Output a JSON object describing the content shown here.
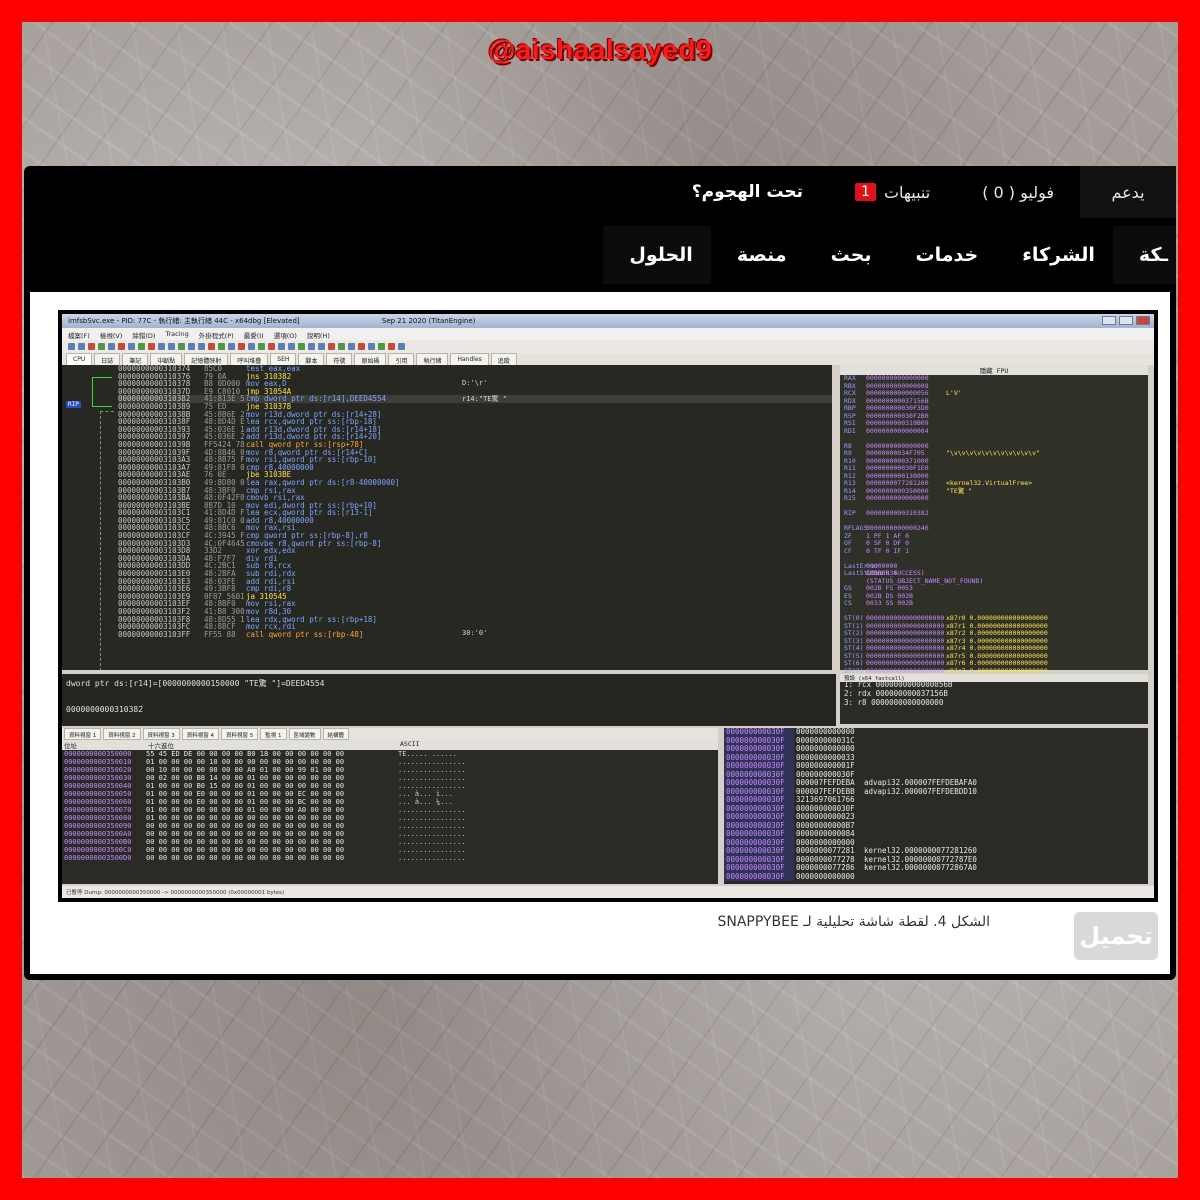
{
  "watermark": "@aishaalsayed9",
  "topbar": {
    "support": "يدعم",
    "follow": "فوليو ( 0 )",
    "alerts_label": "تنبيهات",
    "alerts_count": "1",
    "under_attack": "تحت الهجوم؟"
  },
  "nav": {
    "items": [
      "ـكة",
      "الشركاء",
      "خدمات",
      "بحث",
      "منصة",
      "الحلول"
    ]
  },
  "screenshot": {
    "title": "imfsbSvc.exe - PID: 77C - 執行緒: 主執行緒 44C - x64dbg [Elevated]",
    "date": "Sep 21 2020 (TitanEngine)",
    "menu": [
      "檔案(F)",
      "檢視(V)",
      "除錯(D)",
      "Tracing",
      "外掛程式(P)",
      "最愛(I)",
      "選項(O)",
      "說明(H)"
    ],
    "tabs": [
      "CPU",
      "日誌",
      "筆記",
      "中斷點",
      "記憶體映射",
      "呼叫堆疊",
      "SEH",
      "腳本",
      "符號",
      "原始碼",
      "引用",
      "執行緒",
      "Handles",
      "追蹤"
    ],
    "rip_label": "RIP",
    "disasm": [
      {
        "addr": "0000000000310374",
        "bytes": "85C0",
        "ins": "test eax,eax"
      },
      {
        "addr": "0000000000310376",
        "bytes": "79 0A",
        "ins": "jns 310382"
      },
      {
        "addr": "0000000000310378",
        "bytes": "B8 0D000",
        "ins": "mov eax,D"
      },
      {
        "addr": "000000000031037D",
        "bytes": "E9 C8010",
        "ins": "jmp 31054A"
      },
      {
        "addr": "0000000000310382",
        "bytes": "41:813E 5",
        "ins": "cmp dword ptr ds:[r14],DEED4554"
      },
      {
        "addr": "0000000000310389",
        "bytes": "75 ED",
        "ins": "jne 310378"
      },
      {
        "addr": "000000000031038B",
        "bytes": "45:8B6E 2",
        "ins": "mov r13d,dword ptr ds:[r14+28]"
      },
      {
        "addr": "000000000031038F",
        "bytes": "48:8D4D E",
        "ins": "lea rcx,qword ptr ss:[rbp-18]"
      },
      {
        "addr": "0000000000310393",
        "bytes": "45:036E 1",
        "ins": "add r13d,dword ptr ds:[r14+18]"
      },
      {
        "addr": "0000000000310397",
        "bytes": "45:036E 2",
        "ins": "add r13d,dword ptr ds:[r14+20]"
      },
      {
        "addr": "000000000031039B",
        "bytes": "FF5424 78",
        "ins": "call qword ptr ss:[rsp+78]"
      },
      {
        "addr": "000000000031039F",
        "bytes": "4D:8B46 0",
        "ins": "mov r8,qword ptr ds:[r14+C]"
      },
      {
        "addr": "00000000003103A3",
        "bytes": "48:8B75 F",
        "ins": "mov rsi,qword ptr ss:[rbp-10]"
      },
      {
        "addr": "00000000003103A7",
        "bytes": "49:81F8 0",
        "ins": "cmp r8,40000000"
      },
      {
        "addr": "00000000003103AE",
        "bytes": "76 0E",
        "ins": "jbe 3103BE"
      },
      {
        "addr": "00000000003103B0",
        "bytes": "49:8D80 0",
        "ins": "lea rax,qword ptr ds:[r8-40000000]"
      },
      {
        "addr": "00000000003103B7",
        "bytes": "48:3BF0",
        "ins": "cmp rsi,rax"
      },
      {
        "addr": "00000000003103BA",
        "bytes": "48:0F42F0",
        "ins": "cmovb rsi,rax"
      },
      {
        "addr": "00000000003103BE",
        "bytes": "8B7D 10",
        "ins": "mov edi,dword ptr ss:[rbp+10]"
      },
      {
        "addr": "00000000003103C1",
        "bytes": "41:8D4D F",
        "ins": "lea ecx,qword ptr ds:[r13-1]"
      },
      {
        "addr": "00000000003103C5",
        "bytes": "49:81C0 0",
        "ins": "add r8,40000000"
      },
      {
        "addr": "00000000003103CC",
        "bytes": "48:8BC6",
        "ins": "mov rax,rsi"
      },
      {
        "addr": "00000000003103CF",
        "bytes": "4C:3945 F",
        "ins": "cmp qword ptr ss:[rbp-8],r8"
      },
      {
        "addr": "00000000003103D3",
        "bytes": "4C:0F4645",
        "ins": "cmovbe r8,qword ptr ss:[rbp-8]"
      },
      {
        "addr": "00000000003103D8",
        "bytes": "33D2",
        "ins": "xor edx,edx"
      },
      {
        "addr": "00000000003103DA",
        "bytes": "48:F7F7",
        "ins": "div rdi"
      },
      {
        "addr": "00000000003103DD",
        "bytes": "4C:2BC1",
        "ins": "sub r8,rcx"
      },
      {
        "addr": "00000000003103E0",
        "bytes": "48:2BFA",
        "ins": "sub rdi,rdx"
      },
      {
        "addr": "00000000003103E3",
        "bytes": "48:03FE",
        "ins": "add rdi,rsi"
      },
      {
        "addr": "00000000003103E6",
        "bytes": "49:3BF8",
        "ins": "cmp rdi,r8"
      },
      {
        "addr": "00000000003103E9",
        "bytes": "0F87 5601",
        "ins": "ja 310545"
      },
      {
        "addr": "00000000003103EF",
        "bytes": "48:8BF0",
        "ins": "mov rsi,rax"
      },
      {
        "addr": "00000000003103F2",
        "bytes": "41:B8 300",
        "ins": "mov r8d,30"
      },
      {
        "addr": "00000000003103F8",
        "bytes": "48:8D55 1",
        "ins": "lea rdx,qword ptr ss:[rbp+18]"
      },
      {
        "addr": "00000000003103FC",
        "bytes": "48:8BCF",
        "ins": "mov rcx,rdi"
      },
      {
        "addr": "00000000003103FF",
        "bytes": "FF55 88",
        "ins": "call qword ptr ss:[rbp-48]"
      }
    ],
    "comments": [
      "D:'\\r'",
      "r14:\"TE驚 \"",
      "30:'0'"
    ],
    "regs_header": "隱藏 FPU",
    "regs": [
      {
        "n": "RAX",
        "v": "0000000000000000",
        "c": ""
      },
      {
        "n": "RBX",
        "v": "0000000000000008",
        "c": ""
      },
      {
        "n": "RCX",
        "v": "0000000000000056",
        "c": "L'V'"
      },
      {
        "n": "RDX",
        "v": "000000000037156B",
        "c": ""
      },
      {
        "n": "RBP",
        "v": "000000000030F3D0",
        "c": ""
      },
      {
        "n": "RSP",
        "v": "000000000030F2B0",
        "c": ""
      },
      {
        "n": "RSI",
        "v": "0000000000310B09",
        "c": ""
      },
      {
        "n": "RDI",
        "v": "0000000000000004",
        "c": ""
      },
      {
        "n": "",
        "v": "",
        "c": ""
      },
      {
        "n": "R8",
        "v": "0000000000000000",
        "c": ""
      },
      {
        "n": "R9",
        "v": "00000000034F705",
        "c": "\"\\v\\v\\v\\v\\v\\v\\v\\v\\v\\v\\v\""
      },
      {
        "n": "R10",
        "v": "0000000000371000",
        "c": ""
      },
      {
        "n": "R11",
        "v": "000000000030F1E0",
        "c": ""
      },
      {
        "n": "R12",
        "v": "0000000000130000",
        "c": ""
      },
      {
        "n": "R13",
        "v": "0000000077281260",
        "c": "<kernel32.VirtualFree>"
      },
      {
        "n": "R14",
        "v": "0000000000350000",
        "c": "\"TE驚 \""
      },
      {
        "n": "R15",
        "v": "0000000000000000",
        "c": ""
      },
      {
        "n": "",
        "v": "",
        "c": ""
      },
      {
        "n": "RIP",
        "v": "0000000000310382",
        "c": ""
      },
      {
        "n": "",
        "v": "",
        "c": ""
      },
      {
        "n": "RFLAGS",
        "v": "0000000000000246",
        "c": ""
      },
      {
        "n": "ZF",
        "v": "1  PF 1  AF 0",
        "c": ""
      },
      {
        "n": "OF",
        "v": "0  SF 0  DF 0",
        "c": ""
      },
      {
        "n": "CF",
        "v": "0  TF 0  IF 1",
        "c": ""
      },
      {
        "n": "",
        "v": "",
        "c": ""
      },
      {
        "n": "LastError",
        "v": "00000000 (ERROR_SUCCESS)",
        "c": ""
      },
      {
        "n": "LastStatus",
        "v": "C0000034 (STATUS_OBJECT_NAME_NOT_FOUND)",
        "c": ""
      },
      {
        "n": "",
        "v": "",
        "c": ""
      },
      {
        "n": "GS",
        "v": "002B  FS 0053",
        "c": ""
      },
      {
        "n": "ES",
        "v": "002B  DS 002B",
        "c": ""
      },
      {
        "n": "CS",
        "v": "0033  SS 002B",
        "c": ""
      },
      {
        "n": "",
        "v": "",
        "c": ""
      },
      {
        "n": "ST(0)",
        "v": "00000000000000000000",
        "c": "x87r0 0.000000000000000000"
      },
      {
        "n": "ST(1)",
        "v": "00000000000000000000",
        "c": "x87r1 0.000000000000000000"
      },
      {
        "n": "ST(2)",
        "v": "00000000000000000000",
        "c": "x87r2 0.000000000000000000"
      },
      {
        "n": "ST(3)",
        "v": "00000000000000000000",
        "c": "x87r3 0.000000000000000000"
      },
      {
        "n": "ST(4)",
        "v": "00000000000000000000",
        "c": "x87r4 0.000000000000000000"
      },
      {
        "n": "ST(5)",
        "v": "00000000000000000000",
        "c": "x87r5 0.000000000000000000"
      },
      {
        "n": "ST(6)",
        "v": "00000000000000000000",
        "c": "x87r6 0.000000000000000000"
      },
      {
        "n": "ST(7)",
        "v": "00000000000000000000",
        "c": "x87r7 0.000000000000000000"
      }
    ],
    "stackmini_header": "預設 (x64 fastcall)",
    "stackmini": [
      "1:  rcx 0000000000000056B",
      "2:  rdx 000000000037156B",
      "3:  r8 0000000000000000"
    ],
    "info_line1": "dword ptr ds:[r14]=[0000000000150000 \"TE驚 \"]=DEED4554",
    "info_line2": "0000000000310382",
    "dump_tabs": [
      "資料視窗 1",
      "資料視窗 2",
      "資料視窗 3",
      "資料視窗 4",
      "資料視窗 5",
      "監視 1",
      "區域變數",
      "結構體"
    ],
    "dump_headers": [
      "位址",
      "十六進位",
      "ASCII"
    ],
    "dump": [
      {
        "a": "0000000000350000",
        "x": "55 45 ED DE 00 00 00 00 B0 18 00 00 00 00 00 00",
        "s": "TE.....  ......"
      },
      {
        "a": "0000000000350010",
        "x": "01 00 00 00 00 10 00 00 00 00 00 00 00 00 00 00",
        "s": "................"
      },
      {
        "a": "0000000000350020",
        "x": "00 10 00 00 00 00 00 00 A0 01 00 00 99 01 00 00",
        "s": "................"
      },
      {
        "a": "0000000000350030",
        "x": "00 02 00 00 B8 14 00 00 01 00 00 00 00 00 00 00",
        "s": "................"
      },
      {
        "a": "0000000000350040",
        "x": "01 00 00 00 B0 15 00 00 01 00 00 00 00 00 00 00",
        "s": "................"
      },
      {
        "a": "0000000000350050",
        "x": "01 00 00 00 E0 00 00 00 01 00 00 00 EC 00 00 00",
        "s": "...  à...   ì..."
      },
      {
        "a": "0000000000350060",
        "x": "01 00 00 00 E0 00 00 00 01 00 00 00 BC 00 00 00",
        "s": "...  à...   ¼..."
      },
      {
        "a": "0000000000350070",
        "x": "01 00 00 00 00 00 00 00 01 00 00 00 A0 00 00 00",
        "s": "................"
      },
      {
        "a": "0000000000350080",
        "x": "01 00 00 00 00 00 00 00 00 00 00 00 00 00 00 00",
        "s": "................"
      },
      {
        "a": "0000000000350090",
        "x": "00 00 00 00 00 00 00 00 00 00 00 00 00 00 00 00",
        "s": "................"
      },
      {
        "a": "00000000003500A0",
        "x": "00 00 00 00 00 00 00 00 00 00 00 00 00 00 00 00",
        "s": "................"
      },
      {
        "a": "00000000003500B0",
        "x": "00 00 00 00 00 00 00 00 00 00 00 00 00 00 00 00",
        "s": "................"
      },
      {
        "a": "00000000003500C0",
        "x": "00 00 00 00 00 00 00 00 00 00 00 00 00 00 00 00",
        "s": "................"
      },
      {
        "a": "00000000003500D0",
        "x": "00 00 00 00 00 00 00 00 00 00 00 00 00 00 00 00",
        "s": "................"
      }
    ],
    "stack2": [
      {
        "a": "000000000030F",
        "v": "0000000000000",
        "c": ""
      },
      {
        "a": "000000000030F",
        "v": "000000000031C",
        "c": ""
      },
      {
        "a": "000000000030F",
        "v": "0000000000000",
        "c": ""
      },
      {
        "a": "000000000030F",
        "v": "0000000000033",
        "c": ""
      },
      {
        "a": "000000000030F",
        "v": "000000000001F",
        "c": ""
      },
      {
        "a": "000000000030F",
        "v": "000000000030F",
        "c": ""
      },
      {
        "a": "000000000030F",
        "v": "000007FEFDEBA",
        "c": "advapi32.000007FEFDEBAFA0"
      },
      {
        "a": "000000000030F",
        "v": "000007FEFDEBB",
        "c": "advapi32.000007FEFDEBDD10"
      },
      {
        "a": "000000000030F",
        "v": "3213697061766",
        "c": ""
      },
      {
        "a": "000000000030F",
        "v": "000000000030F",
        "c": ""
      },
      {
        "a": "000000000030F",
        "v": "0000000000023",
        "c": ""
      },
      {
        "a": "000000000030F",
        "v": "00000000000B7",
        "c": ""
      },
      {
        "a": "000000000030F",
        "v": "0000000000084",
        "c": ""
      },
      {
        "a": "000000000030F",
        "v": "0000000000000",
        "c": ""
      },
      {
        "a": "000000000030F",
        "v": "0000000077281",
        "c": "kernel32.0000000077281260"
      },
      {
        "a": "000000000030F",
        "v": "0000000077278",
        "c": "kernel32.00000000772787E0"
      },
      {
        "a": "000000000030F",
        "v": "0000000077286",
        "c": "kernel32.00000000772867A0"
      },
      {
        "a": "000000000030F",
        "v": "0000000000000",
        "c": ""
      }
    ],
    "status": "已暫停  Dump: 0000000000350000 -> 0000000000350000 (0x00000001 bytes)"
  },
  "caption": "SNAPPYBEE الشكل 4. لقطة شاشة تحليلية لـ",
  "download_label": "تحميل"
}
